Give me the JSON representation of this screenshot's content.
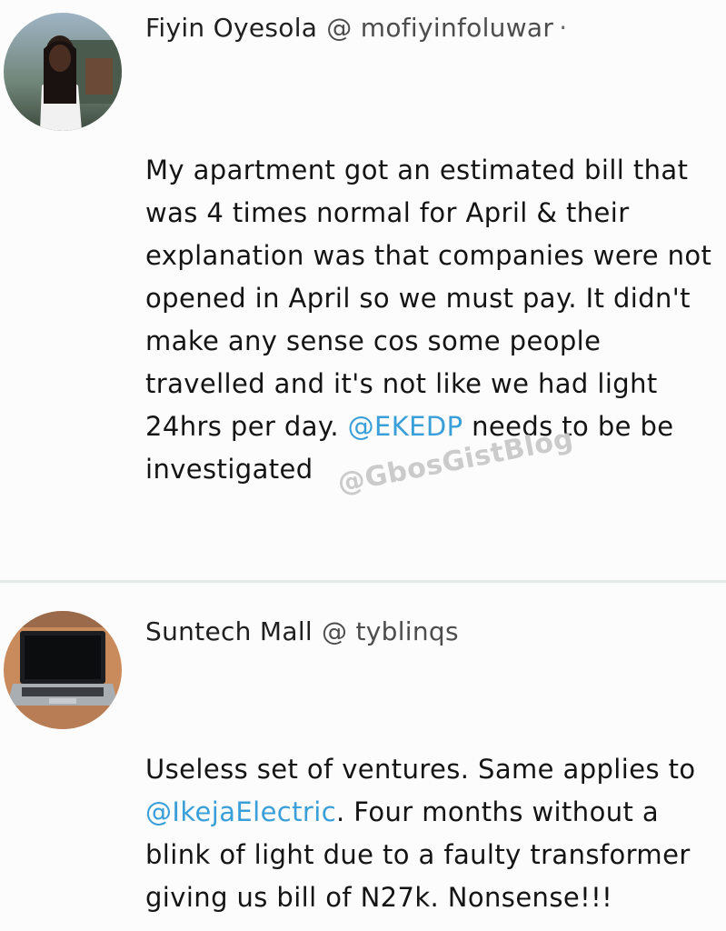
{
  "watermark": "@GbosGistBlog",
  "tweets": [
    {
      "display_name": "Fiyin Oyesola",
      "handle": "@ mofiyinfoluwar",
      "separator": "·",
      "avatar_icon": "user-photo-avatar",
      "body": {
        "part1": "My apartment got an estimated bill that was 4 times normal for April & their explanation was that companies were not opened in April so we must pay. It didn't make any sense cos some people travelled and it's not like we had light 24hrs per day. ",
        "mention": "@EKEDP",
        "part2": " needs to be be investigated"
      }
    },
    {
      "display_name": "Suntech Mall",
      "handle": "@ tyblinqs",
      "avatar_icon": "laptop-avatar",
      "body": {
        "part1": "Useless set of ventures. Same applies to ",
        "mention": "@IkejaElectric",
        "part2": ". Four months without a blink of light due to a faulty transformer giving us bill of N27k. Nonsense!!!"
      }
    }
  ],
  "colors": {
    "background": "#fbfcfb",
    "text": "#141414",
    "mention": "#3a9fd8",
    "divider": "#e4ebe7"
  }
}
